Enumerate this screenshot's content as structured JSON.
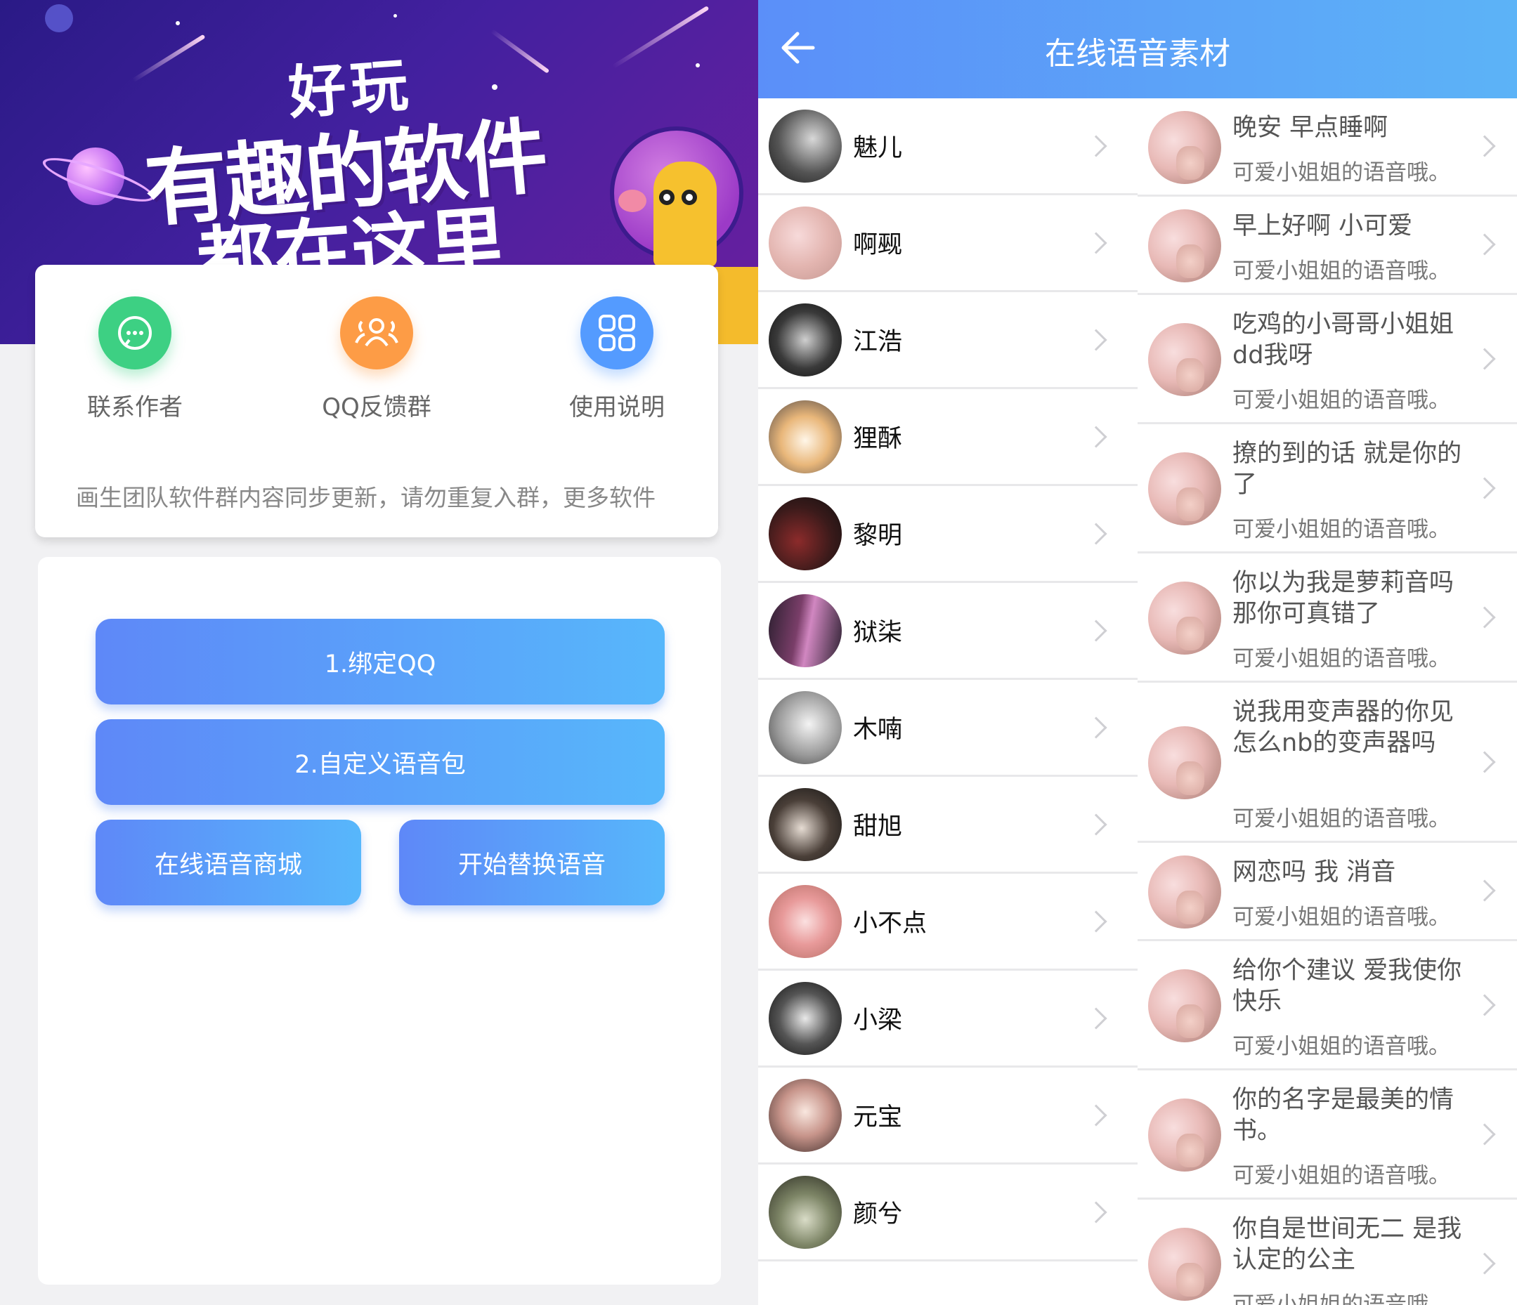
{
  "left": {
    "banner": {
      "small_title": "好玩",
      "main_title": "有趣的软件",
      "sub_title": "都在这里"
    },
    "menu": [
      {
        "label": "联系作者",
        "icon": "chat-bubble-icon",
        "color": "#3dd083"
      },
      {
        "label": "QQ反馈群",
        "icon": "group-icon",
        "color": "#fd9c46"
      },
      {
        "label": "使用说明",
        "icon": "grid-apps-icon",
        "color": "#549bff"
      }
    ],
    "notice": "画生团队软件群内容同步更新，请勿重复入群，更多软件",
    "buttons": {
      "bind_qq": "1.绑定QQ",
      "custom_pack": "2.自定义语音包",
      "online_store": "在线语音商城",
      "start_replace": "开始替换语音"
    }
  },
  "right": {
    "header": {
      "title": "在线语音素材",
      "back_icon": "arrow-left-icon"
    },
    "users": [
      {
        "name": "魅儿"
      },
      {
        "name": "啊觋"
      },
      {
        "name": "江浩"
      },
      {
        "name": "狸酥"
      },
      {
        "name": "黎明"
      },
      {
        "name": "狱柒"
      },
      {
        "name": "木喃"
      },
      {
        "name": "甜旭"
      },
      {
        "name": "小不点"
      },
      {
        "name": "小梁"
      },
      {
        "name": "元宝"
      },
      {
        "name": "颜兮"
      }
    ],
    "voices": [
      {
        "title": "晚安 早点睡啊",
        "sub": "可爱小姐姐的语音哦。"
      },
      {
        "title": "早上好啊 小可爱",
        "sub": "可爱小姐姐的语音哦。"
      },
      {
        "title": "吃鸡的小哥哥小姐姐dd我呀",
        "sub": "可爱小姐姐的语音哦。"
      },
      {
        "title": "撩的到的话 就是你的了",
        "sub": "可爱小姐姐的语音哦。"
      },
      {
        "title": "你以为我是萝莉音吗 那你可真错了",
        "sub": "可爱小姐姐的语音哦。"
      },
      {
        "title": "说我用变声器的你见怎么nb的变声器吗",
        "sub": "可爱小姐姐的语音哦。"
      },
      {
        "title": "网恋吗 我 消音",
        "sub": "可爱小姐姐的语音哦。"
      },
      {
        "title": "给你个建议 爱我使你快乐",
        "sub": "可爱小姐姐的语音哦。"
      },
      {
        "title": "你的名字是最美的情书。",
        "sub": "可爱小姐姐的语音哦。"
      },
      {
        "title": "你自是世间无二 是我认定的公主",
        "sub": "可爱小姐姐的语音哦。"
      }
    ]
  }
}
